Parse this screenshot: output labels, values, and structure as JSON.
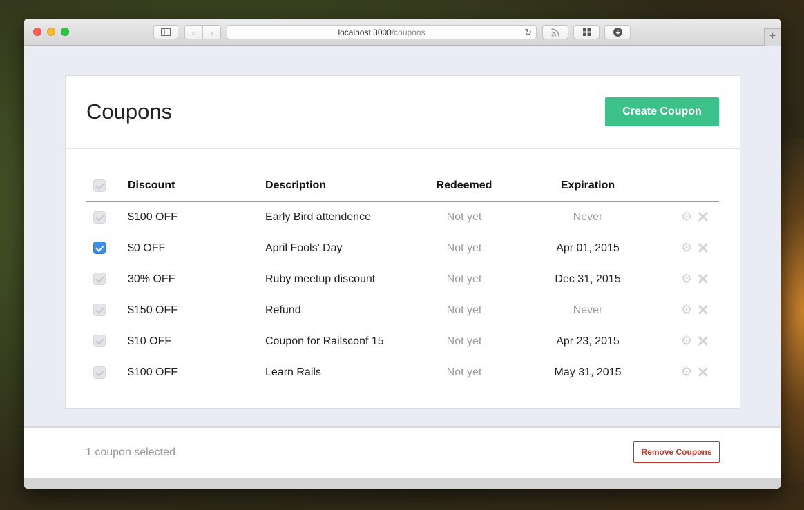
{
  "browser": {
    "url_host": "localhost:3000",
    "url_path": "/coupons",
    "new_tab_label": "+"
  },
  "page": {
    "title": "Coupons",
    "create_button": "Create Coupon"
  },
  "table": {
    "columns": [
      "Discount",
      "Description",
      "Redeemed",
      "Expiration"
    ],
    "rows": [
      {
        "discount": "$100 OFF",
        "description": "Early Bird attendence",
        "redeemed": "Not yet",
        "expiration": "Never",
        "checked": false
      },
      {
        "discount": "$0 OFF",
        "description": "April Fools' Day",
        "redeemed": "Not yet",
        "expiration": "Apr 01, 2015",
        "checked": true
      },
      {
        "discount": "30% OFF",
        "description": "Ruby meetup discount",
        "redeemed": "Not yet",
        "expiration": "Dec 31, 2015",
        "checked": false
      },
      {
        "discount": "$150 OFF",
        "description": "Refund",
        "redeemed": "Not yet",
        "expiration": "Never",
        "checked": false
      },
      {
        "discount": "$10 OFF",
        "description": "Coupon for Railsconf 15",
        "redeemed": "Not yet",
        "expiration": "Apr 23, 2015",
        "checked": false
      },
      {
        "discount": "$100 OFF",
        "description": "Learn Rails",
        "redeemed": "Not yet",
        "expiration": "May 31, 2015",
        "checked": false
      }
    ]
  },
  "footer": {
    "status": "1 coupon selected",
    "remove_button": "Remove Coupons"
  },
  "colors": {
    "accent_green": "#3cc18a",
    "danger_red": "#c0392b",
    "checkbox_blue": "#3c8ee8"
  }
}
